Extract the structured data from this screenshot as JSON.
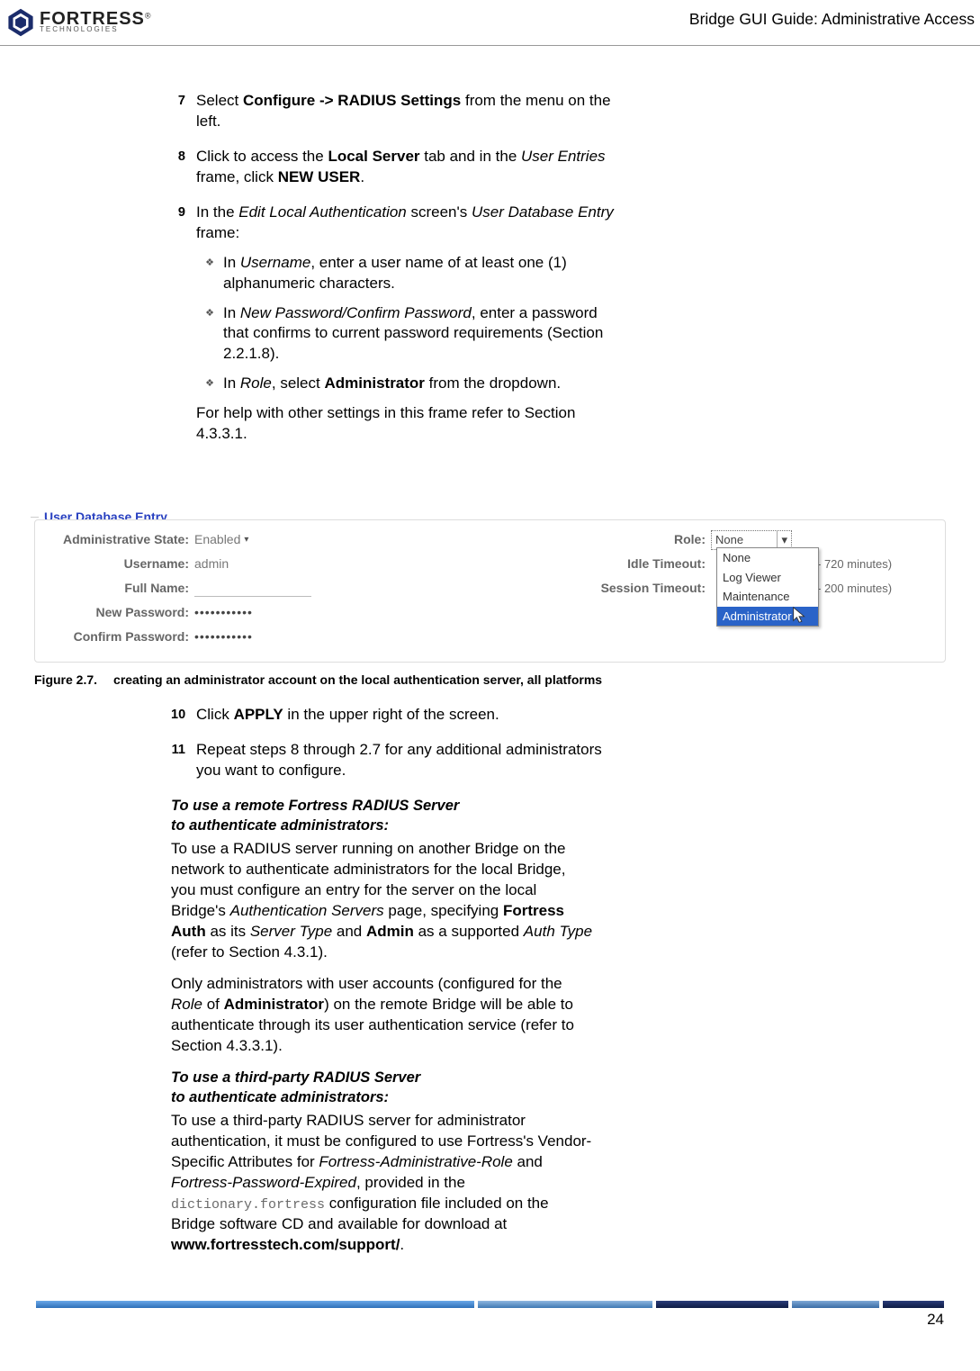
{
  "header": {
    "logo_main": "FORTRESS",
    "logo_sub": "TECHNOLOGIES",
    "right_text": "Bridge GUI Guide: Administrative Access"
  },
  "steps": {
    "s7_num": "7",
    "s7_a": "Select ",
    "s7_b": "Configure -> RADIUS Settings",
    "s7_c": " from the menu on the left.",
    "s8_num": "8",
    "s8_a": "Click to access the ",
    "s8_b": "Local Server",
    "s8_c": " tab and in the ",
    "s8_d": "User Entries",
    "s8_e": " frame, click ",
    "s8_f": "NEW USER",
    "s8_g": ".",
    "s9_num": "9",
    "s9_a": "In the ",
    "s9_b": "Edit Local Authentication",
    "s9_c": " screen's ",
    "s9_d": "User Database Entry",
    "s9_e": " frame:",
    "b1_a": "In ",
    "b1_b": "Username",
    "b1_c": ", enter a user name of at least one (1) alphanumeric characters.",
    "b2_a": "In ",
    "b2_b": "New Password/Confirm Password",
    "b2_c": ", enter a password that confirms to current password requirements (Section 2.2.1.8).",
    "b3_a": "In ",
    "b3_b": "Role",
    "b3_c": ", select ",
    "b3_d": "Administrator",
    "b3_e": " from the dropdown.",
    "s9_tail": "For help with other settings in this frame refer to Section 4.3.3.1.",
    "s10_num": "10",
    "s10_a": "Click ",
    "s10_b": "APPLY",
    "s10_c": " in the upper right of the screen.",
    "s11_num": "11",
    "s11_text": "Repeat steps 8 through 2.7 for any additional administrators you want to configure."
  },
  "figure": {
    "fieldset_title": "User Database Entry",
    "labels": {
      "admin_state": "Administrative State:",
      "username": "Username:",
      "full_name": "Full Name:",
      "new_pw": "New Password:",
      "confirm_pw": "Confirm Password:",
      "role": "Role:",
      "idle": "Idle Timeout:",
      "session": "Session Timeout:"
    },
    "values": {
      "admin_state": "Enabled",
      "username": "admin",
      "role_selected": "None",
      "pw_dots": "•••••••••••",
      "idle_hint": "- 720 minutes)",
      "session_hint": "- 200 minutes)"
    },
    "dropdown": [
      "None",
      "Log Viewer",
      "Maintenance",
      "Administrator"
    ],
    "caption_label": "Figure 2.7.",
    "caption_text": "creating an administrator account on the local authentication server, all platforms"
  },
  "sections": {
    "sub1_l1": "To use a remote Fortress RADIUS Server",
    "sub1_l2": "to authenticate administrators:",
    "p1_a": "To use a RADIUS server running on another Bridge on the network to authenticate administrators for the local Bridge, you must configure an entry for the server on the local Bridge's ",
    "p1_b": "Authentication Servers",
    "p1_c": " page, specifying ",
    "p1_d": "Fortress Auth",
    "p1_e": " as its ",
    "p1_f": "Server Type",
    "p1_g": " and ",
    "p1_h": "Admin",
    "p1_i": " as a supported ",
    "p1_j": "Auth Type",
    "p1_k": " (refer to Section 4.3.1).",
    "p2_a": "Only administrators with user accounts (configured for the ",
    "p2_b": "Role",
    "p2_c": " of ",
    "p2_d": "Administrator",
    "p2_e": ") on the remote Bridge will be able to authenticate through its user authentication service (refer to Section 4.3.3.1).",
    "sub2_l1": "To use a third-party RADIUS Server",
    "sub2_l2": "to authenticate administrators:",
    "p3_a": "To use a third-party RADIUS server for administrator authentication, it must be configured to use Fortress's Vendor-Specific Attributes for ",
    "p3_b": "Fortress-Administrative-Role",
    "p3_c": " and ",
    "p3_d": "Fortress-Password-Expired",
    "p3_e": ", provided in the ",
    "p3_f": "dictionary.fortress",
    "p3_g": " configuration file included on the Bridge software CD and available for download at ",
    "p3_h": "www.fortresstech.com/support/",
    "p3_i": "."
  },
  "page_number": "24"
}
